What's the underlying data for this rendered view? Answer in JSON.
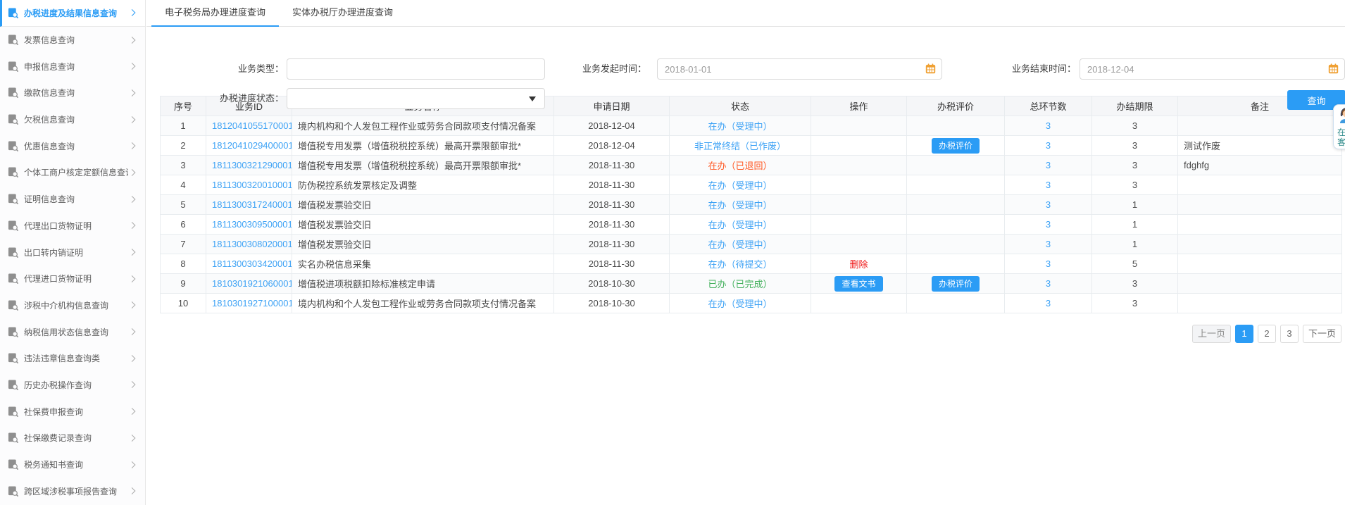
{
  "colors": {
    "accent": "#2b9cf5",
    "link": "#3da2f5",
    "status_orange": "#ff5722",
    "status_green": "#43b05c",
    "danger_red": "#ee1111",
    "calendar_orange": "#f0a032"
  },
  "sidebar": {
    "items": [
      {
        "name": "sidebar-item-progress-result-query",
        "icon": "progress-result-search-icon",
        "label": "办税进度及结果信息查询",
        "state": "active"
      },
      {
        "name": "sidebar-item-invoice-info",
        "icon": "invoice-search-icon",
        "label": "发票信息查询",
        "state": ""
      },
      {
        "name": "sidebar-item-declaration-info",
        "icon": "declaration-search-icon",
        "label": "申报信息查询",
        "state": ""
      },
      {
        "name": "sidebar-item-payment-info",
        "icon": "payment-search-icon",
        "label": "缴款信息查询",
        "state": ""
      },
      {
        "name": "sidebar-item-tax-arrears-info",
        "icon": "tax-arrears-search-icon",
        "label": "欠税信息查询",
        "state": ""
      },
      {
        "name": "sidebar-item-preferential-info",
        "icon": "preferential-search-icon",
        "label": "优惠信息查询",
        "state": ""
      },
      {
        "name": "sidebar-item-individual-quota-info",
        "icon": "individual-quota-search-icon",
        "label": "个体工商户核定定额信息查询",
        "state": ""
      },
      {
        "name": "sidebar-item-certificate-info",
        "icon": "certificate-search-icon",
        "label": "证明信息查询",
        "state": ""
      },
      {
        "name": "sidebar-item-agent-export-cert",
        "icon": "agent-export-cert-icon",
        "label": "代理出口货物证明",
        "state": ""
      },
      {
        "name": "sidebar-item-export-domestic-cert",
        "icon": "export-domestic-cert-icon",
        "label": "出口转内销证明",
        "state": ""
      },
      {
        "name": "sidebar-item-agent-import-cert",
        "icon": "agent-import-cert-icon",
        "label": "代理进口货物证明",
        "state": ""
      },
      {
        "name": "sidebar-item-tax-intermediary-info",
        "icon": "tax-intermediary-search-icon",
        "label": "涉税中介机构信息查询",
        "state": ""
      },
      {
        "name": "sidebar-item-tax-credit-status",
        "icon": "tax-credit-search-icon",
        "label": "纳税信用状态信息查询",
        "state": ""
      },
      {
        "name": "sidebar-item-violation-info",
        "icon": "violation-search-icon",
        "label": "违法违章信息查询类",
        "state": ""
      },
      {
        "name": "sidebar-item-history-operation",
        "icon": "history-operation-search-icon",
        "label": "历史办税操作查询",
        "state": ""
      },
      {
        "name": "sidebar-item-social-insurance-declare",
        "icon": "social-insurance-declare-icon",
        "label": "社保费申报查询",
        "state": ""
      },
      {
        "name": "sidebar-item-social-insurance-record",
        "icon": "social-insurance-record-icon",
        "label": "社保缴费记录查询",
        "state": ""
      },
      {
        "name": "sidebar-item-tax-notice",
        "icon": "tax-notice-search-icon",
        "label": "税务通知书查询",
        "state": ""
      },
      {
        "name": "sidebar-item-cross-region-report",
        "icon": "cross-region-report-icon",
        "label": "跨区域涉税事项报告查询",
        "state": ""
      }
    ]
  },
  "tabs": [
    {
      "name": "tab-electronic-bureau-progress",
      "label": "电子税务局办理进度查询",
      "state": "active"
    },
    {
      "name": "tab-service-hall-progress",
      "label": "实体办税厅办理进度查询",
      "state": ""
    }
  ],
  "filters": {
    "business_type_label": "业务类型：",
    "business_type_value": "",
    "progress_status_label": "办税进度状态：",
    "progress_status_value": "",
    "start_time_label": "业务发起时间：",
    "start_time_value": "2018-01-01",
    "end_time_label": "业务结束时间：",
    "end_time_value": "2018-12-04",
    "query_button": "查询"
  },
  "table": {
    "headers": [
      "序号",
      "业务ID",
      "业务名称",
      "申请日期",
      "状态",
      "操作",
      "办税评价",
      "总环节数",
      "办结期限",
      "备注"
    ],
    "rows": [
      {
        "index": "1",
        "id": "1812041055170001",
        "name": "境内机构和个人发包工程作业或劳务合同款项支付情况备案",
        "date": "2018-12-04",
        "status": "在办（受理中）",
        "status_color": "blue",
        "action_link": "",
        "action_button": "",
        "evaluate_button": "",
        "total_steps": "3",
        "deadline": "3",
        "remark": ""
      },
      {
        "index": "2",
        "id": "1812041029400001",
        "name": "增值税专用发票（增值税税控系统）最高开票限额审批*",
        "date": "2018-12-04",
        "status": "非正常终结（已作废）",
        "status_color": "blue",
        "action_link": "",
        "action_button": "",
        "evaluate_button": "办税评价",
        "total_steps": "3",
        "deadline": "3",
        "remark": "测试作废"
      },
      {
        "index": "3",
        "id": "1811300321290001",
        "name": "增值税专用发票（增值税税控系统）最高开票限额审批*",
        "date": "2018-11-30",
        "status": "在办（已退回）",
        "status_color": "orange",
        "action_link": "",
        "action_button": "",
        "evaluate_button": "",
        "total_steps": "3",
        "deadline": "3",
        "remark": "fdghfg"
      },
      {
        "index": "4",
        "id": "1811300320010001",
        "name": "防伪税控系统发票核定及调整",
        "date": "2018-11-30",
        "status": "在办（受理中）",
        "status_color": "blue",
        "action_link": "",
        "action_button": "",
        "evaluate_button": "",
        "total_steps": "3",
        "deadline": "3",
        "remark": ""
      },
      {
        "index": "5",
        "id": "1811300317240001",
        "name": "增值税发票验交旧",
        "date": "2018-11-30",
        "status": "在办（受理中）",
        "status_color": "blue",
        "action_link": "",
        "action_button": "",
        "evaluate_button": "",
        "total_steps": "3",
        "deadline": "1",
        "remark": ""
      },
      {
        "index": "6",
        "id": "1811300309500001",
        "name": "增值税发票验交旧",
        "date": "2018-11-30",
        "status": "在办（受理中）",
        "status_color": "blue",
        "action_link": "",
        "action_button": "",
        "evaluate_button": "",
        "total_steps": "3",
        "deadline": "1",
        "remark": ""
      },
      {
        "index": "7",
        "id": "1811300308020001",
        "name": "增值税发票验交旧",
        "date": "2018-11-30",
        "status": "在办（受理中）",
        "status_color": "blue",
        "action_link": "",
        "action_button": "",
        "evaluate_button": "",
        "total_steps": "3",
        "deadline": "1",
        "remark": ""
      },
      {
        "index": "8",
        "id": "1811300303420001",
        "name": "实名办税信息采集",
        "date": "2018-11-30",
        "status": "在办（待提交）",
        "status_color": "blue",
        "action_link": "删除",
        "action_button": "",
        "evaluate_button": "",
        "total_steps": "3",
        "deadline": "5",
        "remark": ""
      },
      {
        "index": "9",
        "id": "1810301921060001",
        "name": "增值税进项税额扣除标准核定申请",
        "date": "2018-10-30",
        "status": "已办（已完成）",
        "status_color": "green",
        "action_link": "",
        "action_button": "查看文书",
        "evaluate_button": "办税评价",
        "total_steps": "3",
        "deadline": "3",
        "remark": ""
      },
      {
        "index": "10",
        "id": "1810301927100001",
        "name": "境内机构和个人发包工程作业或劳务合同款项支付情况备案",
        "date": "2018-10-30",
        "status": "在办（受理中）",
        "status_color": "blue",
        "action_link": "",
        "action_button": "",
        "evaluate_button": "",
        "total_steps": "3",
        "deadline": "3",
        "remark": ""
      }
    ]
  },
  "pagination": {
    "prev": "上一页",
    "pages": [
      {
        "label": "1",
        "state": "active"
      },
      {
        "label": "2",
        "state": ""
      },
      {
        "label": "3",
        "state": ""
      }
    ],
    "next": "下一页"
  },
  "service_widget": {
    "line1": "在线",
    "line2": "客服"
  }
}
